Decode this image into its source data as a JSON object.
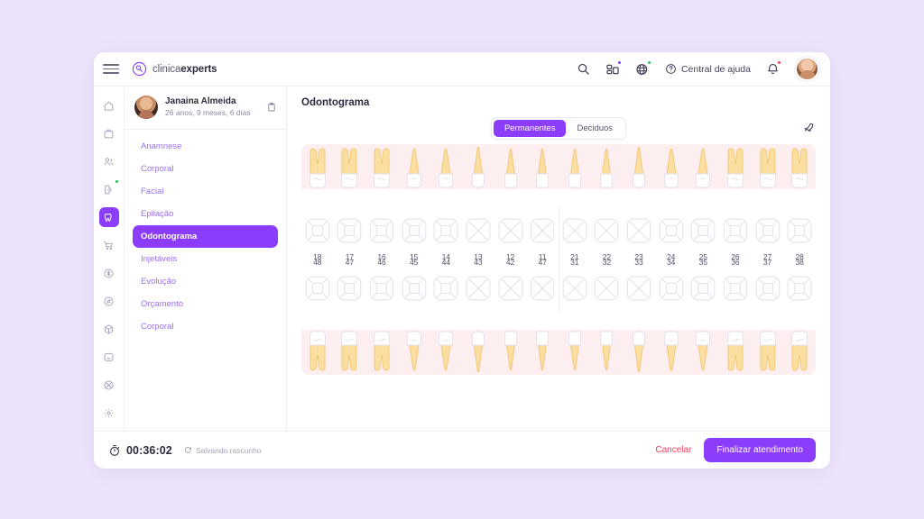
{
  "brand": {
    "name_light": "clinica",
    "name_bold": "experts",
    "accent": "#8b3dfb"
  },
  "topbar": {
    "menu_icon": "hamburger-icon",
    "search_icon": "search-icon",
    "apps_icon": "apps-icon",
    "globe_icon": "globe-icon",
    "help_icon": "help-circle-icon",
    "help_label": "Central de ajuda",
    "bell_icon": "bell-icon",
    "avatar": "user-avatar"
  },
  "rail": {
    "items": [
      {
        "icon": "home-icon",
        "active": false,
        "badge": ""
      },
      {
        "icon": "briefcase-icon",
        "active": false,
        "badge": ""
      },
      {
        "icon": "users-icon",
        "active": false,
        "badge": ""
      },
      {
        "icon": "door-icon",
        "active": false,
        "badge": "green"
      },
      {
        "icon": "tooth-icon",
        "active": true,
        "badge": ""
      },
      {
        "icon": "cart-icon",
        "active": false,
        "badge": ""
      },
      {
        "icon": "dollar-icon",
        "active": false,
        "badge": ""
      },
      {
        "icon": "compass-icon",
        "active": false,
        "badge": ""
      },
      {
        "icon": "box-icon",
        "active": false,
        "badge": ""
      },
      {
        "icon": "chat-icon",
        "active": false,
        "badge": ""
      },
      {
        "icon": "help-icon",
        "active": false,
        "badge": ""
      },
      {
        "icon": "gear-icon",
        "active": false,
        "badge": ""
      }
    ]
  },
  "patient": {
    "name": "Janaina Almeida",
    "age": "26 anos, 9 meses, 6 dias",
    "clipboard_icon": "clipboard-icon"
  },
  "nav": {
    "items": [
      {
        "label": "Anamnese",
        "active": false
      },
      {
        "label": "Corporal",
        "active": false
      },
      {
        "label": "Facial",
        "active": false
      },
      {
        "label": "Epilação",
        "active": false
      },
      {
        "label": "Odontograma",
        "active": true
      },
      {
        "label": "Injetáveis",
        "active": false
      },
      {
        "label": "Evolução",
        "active": false
      },
      {
        "label": "Orçamento",
        "active": false
      },
      {
        "label": "Corporal",
        "active": false
      }
    ]
  },
  "main": {
    "title": "Odontograma",
    "rocket_icon": "rocket-icon",
    "tabs": [
      {
        "label": "Permanentes",
        "active": true
      },
      {
        "label": "Deciduos",
        "active": false
      }
    ]
  },
  "odontogram": {
    "gum_color": "#fdeef0",
    "root_color": "#fbdfa0",
    "outline_color": "#e4e2ec",
    "upper_left": [
      {
        "num": "18",
        "type": "molar",
        "surface": "quad"
      },
      {
        "num": "17",
        "type": "molar",
        "surface": "quad"
      },
      {
        "num": "16",
        "type": "molar",
        "surface": "quad"
      },
      {
        "num": "15",
        "type": "premolar",
        "surface": "quad"
      },
      {
        "num": "14",
        "type": "premolar",
        "surface": "quad"
      },
      {
        "num": "13",
        "type": "canine",
        "surface": "cross"
      },
      {
        "num": "12",
        "type": "incisor",
        "surface": "cross"
      },
      {
        "num": "11",
        "type": "incisor",
        "surface": "cross"
      }
    ],
    "upper_right": [
      {
        "num": "21",
        "type": "incisor",
        "surface": "cross"
      },
      {
        "num": "22",
        "type": "incisor",
        "surface": "cross"
      },
      {
        "num": "23",
        "type": "canine",
        "surface": "cross"
      },
      {
        "num": "24",
        "type": "premolar",
        "surface": "quad"
      },
      {
        "num": "25",
        "type": "premolar",
        "surface": "quad"
      },
      {
        "num": "26",
        "type": "molar",
        "surface": "quad"
      },
      {
        "num": "27",
        "type": "molar",
        "surface": "quad"
      },
      {
        "num": "28",
        "type": "molar",
        "surface": "quad"
      }
    ],
    "lower_left": [
      {
        "num": "48",
        "type": "molar",
        "surface": "quad"
      },
      {
        "num": "47",
        "type": "molar",
        "surface": "quad"
      },
      {
        "num": "46",
        "type": "molar",
        "surface": "quad"
      },
      {
        "num": "45",
        "type": "premolar",
        "surface": "quad"
      },
      {
        "num": "44",
        "type": "premolar",
        "surface": "quad"
      },
      {
        "num": "43",
        "type": "canine",
        "surface": "cross"
      },
      {
        "num": "42",
        "type": "incisor",
        "surface": "cross"
      },
      {
        "num": "47",
        "type": "incisor",
        "surface": "cross"
      }
    ],
    "lower_right": [
      {
        "num": "31",
        "type": "incisor",
        "surface": "cross"
      },
      {
        "num": "32",
        "type": "incisor",
        "surface": "cross"
      },
      {
        "num": "33",
        "type": "canine",
        "surface": "cross"
      },
      {
        "num": "34",
        "type": "premolar",
        "surface": "quad"
      },
      {
        "num": "35",
        "type": "premolar",
        "surface": "quad"
      },
      {
        "num": "36",
        "type": "molar",
        "surface": "quad"
      },
      {
        "num": "37",
        "type": "molar",
        "surface": "quad"
      },
      {
        "num": "38",
        "type": "molar",
        "surface": "quad"
      }
    ]
  },
  "footer": {
    "timer_icon": "stopwatch-icon",
    "timer": "00:36:02",
    "saving_icon": "sync-icon",
    "saving_label": "Salvando rascunho",
    "cancel_label": "Cancelar",
    "finish_label": "Finalizar atendimento"
  }
}
